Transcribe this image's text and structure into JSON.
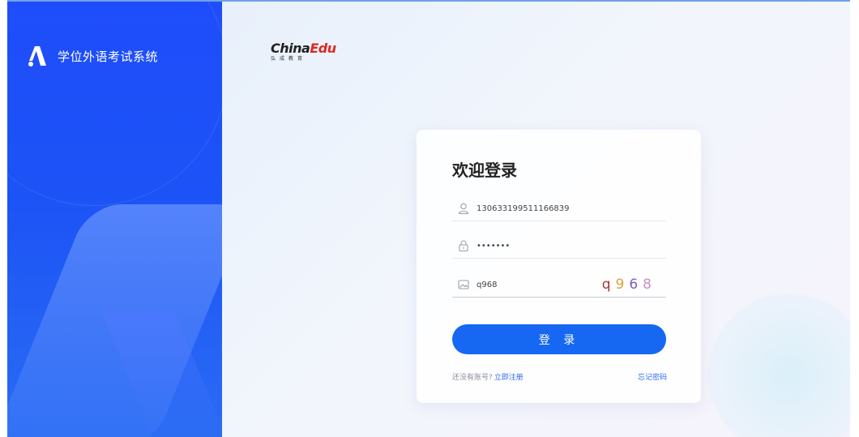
{
  "app": {
    "title": "学位外语考试系统"
  },
  "partner": {
    "logo_word_1": "China",
    "logo_word_2": "Edu",
    "logo_sub": "弘成教育"
  },
  "login": {
    "title": "欢迎登录",
    "username_value": "130633199511166839",
    "password_value": "•••••••",
    "captcha_input_value": "q968",
    "captcha_image_chars": [
      "q",
      "9",
      "6",
      "8"
    ],
    "captcha_colors": [
      "#a33a2a",
      "#d8a43a",
      "#7a5bc8",
      "#c792c9"
    ],
    "submit_label": "登 录",
    "no_account_text": "还没有账号?",
    "register_link": "立即注册",
    "forgot_link": "忘记密码"
  },
  "icons": {
    "brand": "a-triangle-logo-icon",
    "username": "user-icon",
    "password": "lock-icon",
    "captcha": "image-icon"
  },
  "colors": {
    "sidebar": "#1f4dfb",
    "button": "#1668f2",
    "link": "#2f6cf0"
  }
}
